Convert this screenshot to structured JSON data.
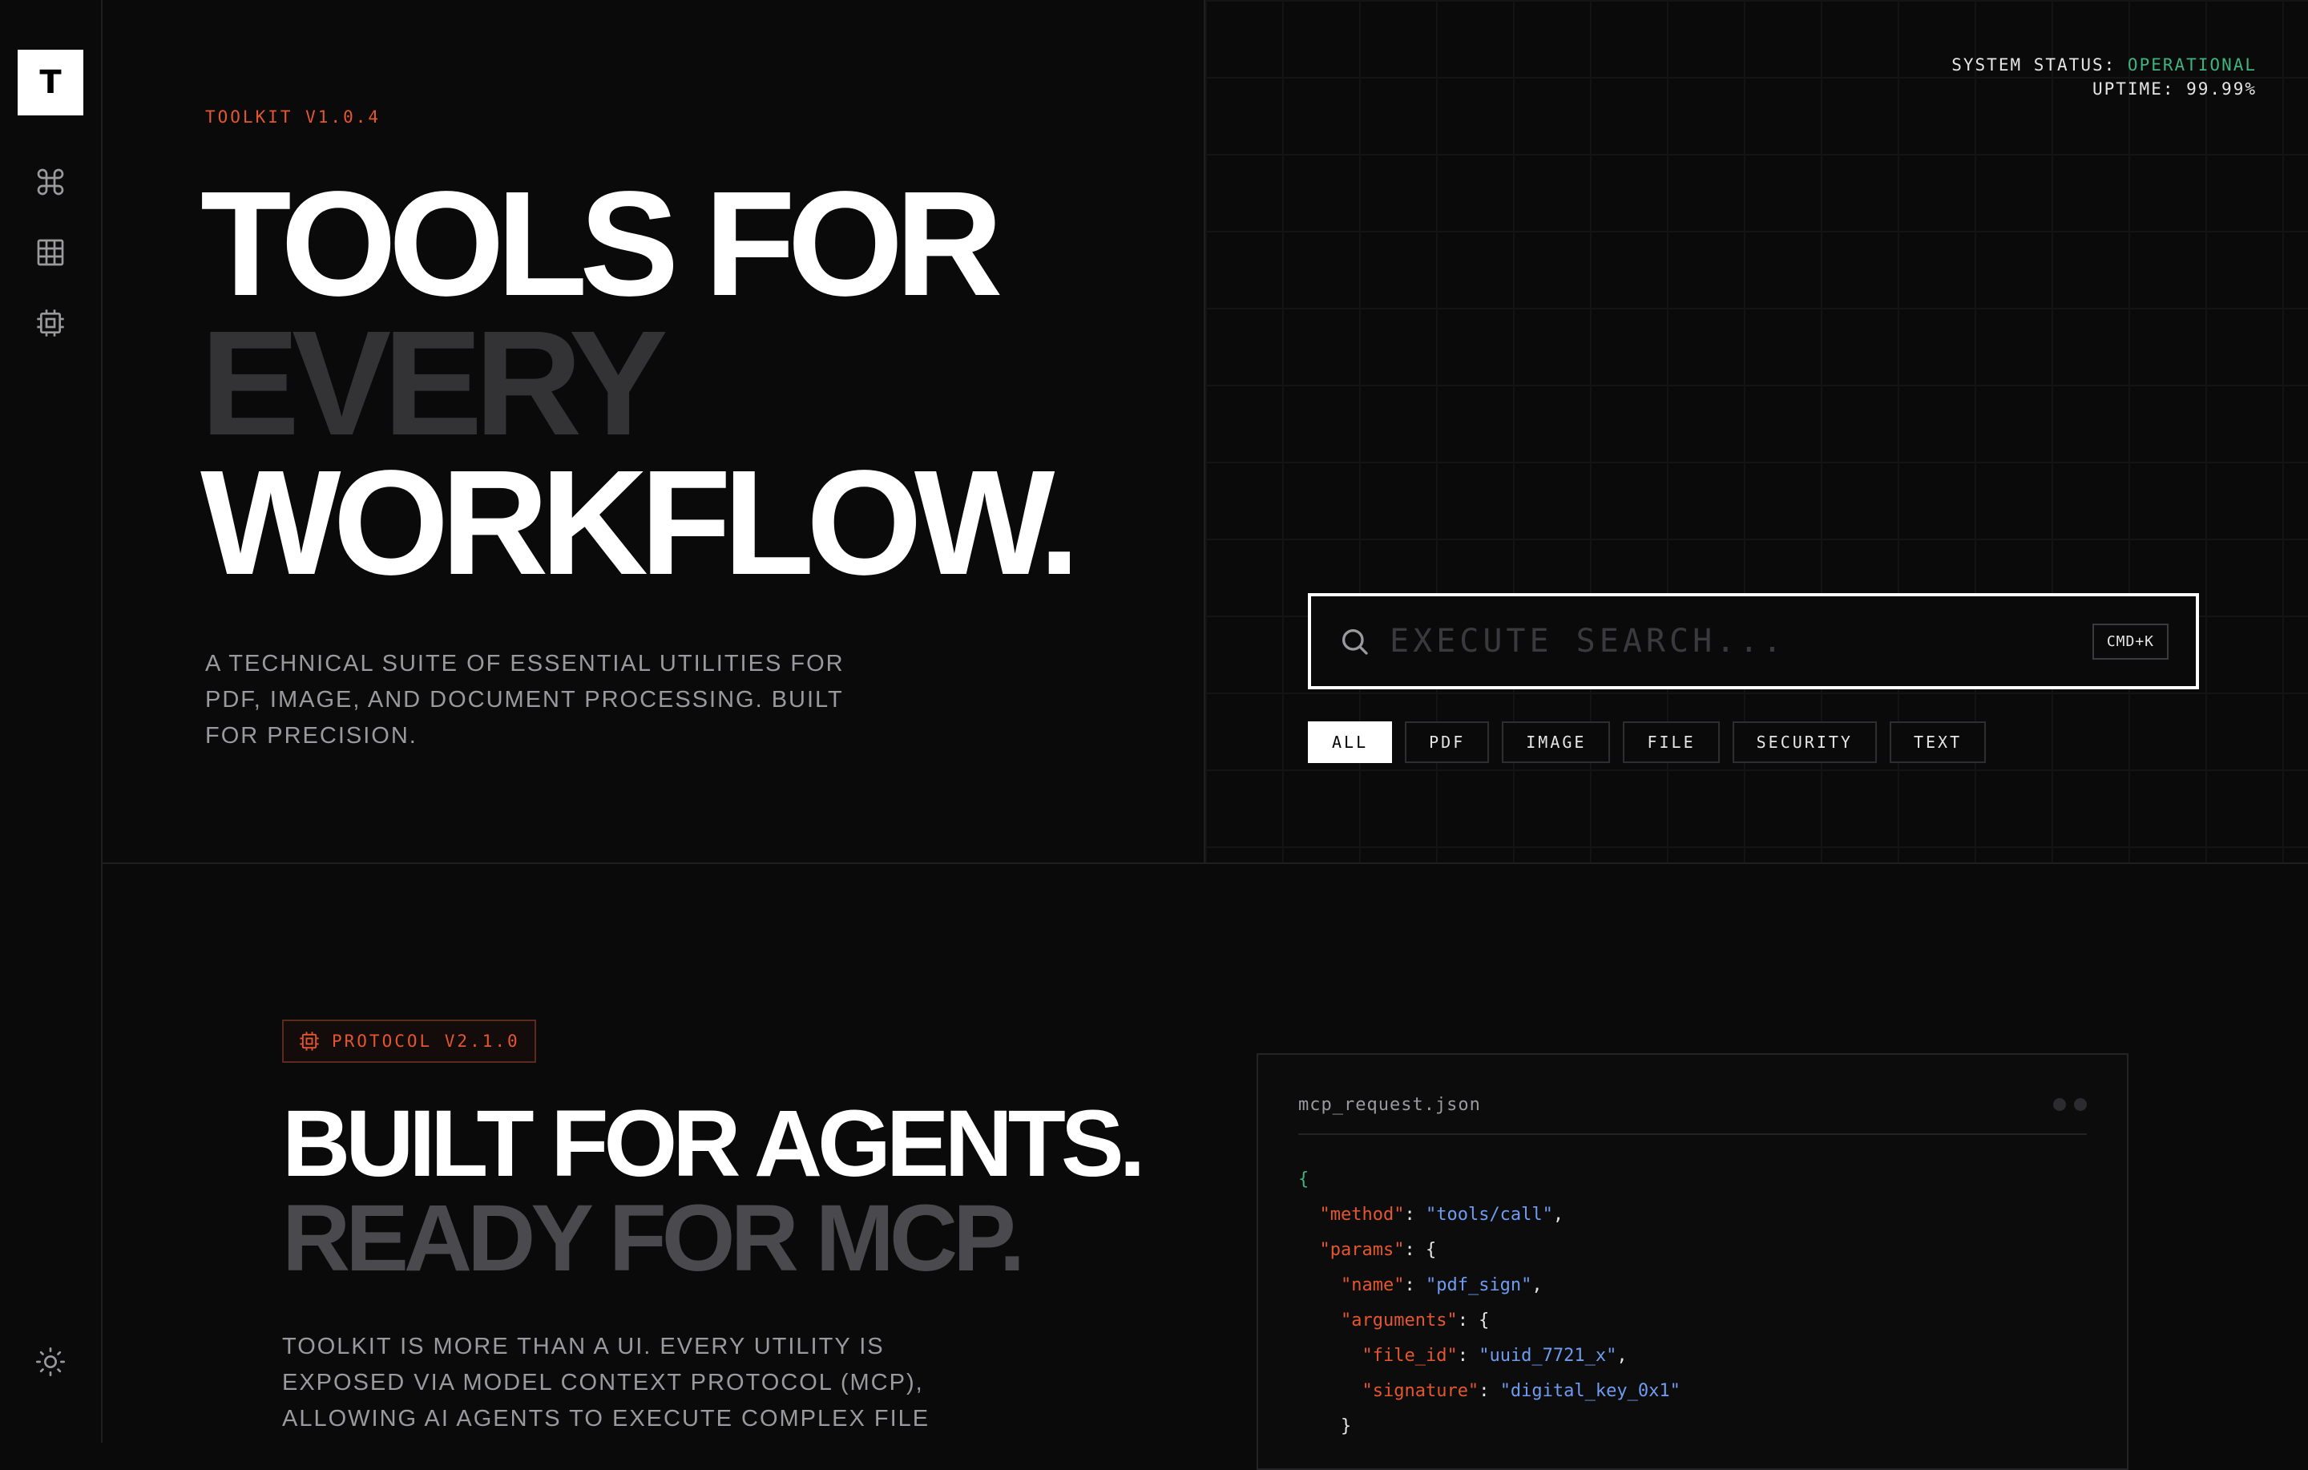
{
  "sidebar": {
    "logo": "T",
    "items": [
      {
        "icon": "command-icon"
      },
      {
        "icon": "grid-icon"
      },
      {
        "icon": "chip-icon"
      }
    ],
    "bottom_icon": "sun-icon"
  },
  "hero": {
    "version": "TOOLKIT V1.0.4",
    "headline_line1": "TOOLS FOR",
    "headline_line2": "EVERY",
    "headline_line3": "WORKFLOW.",
    "description": "A TECHNICAL SUITE OF ESSENTIAL UTILITIES FOR PDF, IMAGE, AND DOCUMENT PROCESSING. BUILT FOR PRECISION."
  },
  "status": {
    "label": "SYSTEM STATUS:",
    "value": "OPERATIONAL",
    "uptime": "UPTIME: 99.99%"
  },
  "search": {
    "placeholder": "EXECUTE SEARCH...",
    "shortcut": "CMD+K"
  },
  "filters": [
    {
      "label": "ALL",
      "active": true
    },
    {
      "label": "PDF",
      "active": false
    },
    {
      "label": "IMAGE",
      "active": false
    },
    {
      "label": "FILE",
      "active": false
    },
    {
      "label": "SECURITY",
      "active": false
    },
    {
      "label": "TEXT",
      "active": false
    }
  ],
  "agents": {
    "badge": "PROTOCOL V2.1.0",
    "headline_line1": "BUILT FOR AGENTS.",
    "headline_line2": "READY FOR MCP.",
    "description": "TOOLKIT IS MORE THAN A UI. EVERY UTILITY IS EXPOSED VIA MODEL CONTEXT PROTOCOL (MCP), ALLOWING AI AGENTS TO EXECUTE COMPLEX FILE"
  },
  "code": {
    "filename": "mcp_request.json",
    "open_brace": "{",
    "method_key": "\"method\"",
    "method_val": "\"tools/call\"",
    "params_key": "\"params\"",
    "name_key": "\"name\"",
    "name_val": "\"pdf_sign\"",
    "arguments_key": "\"arguments\"",
    "file_id_key": "\"file_id\"",
    "file_id_val": "\"uuid_7721_x\"",
    "signature_key": "\"signature\"",
    "signature_val": "\"digital_key_0x1\"",
    "close_brace": "}"
  },
  "colors": {
    "accent": "#e4572e",
    "status_ok": "#3fb37f",
    "string": "#6f9cf0",
    "background": "#0a0a0b"
  }
}
